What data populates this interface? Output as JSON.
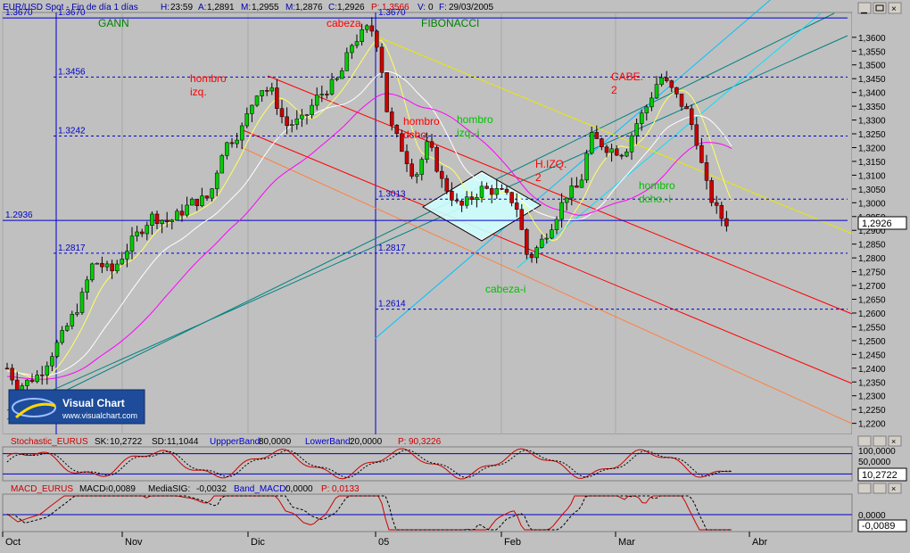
{
  "header": {
    "symbol": "EUR/USD Spot - Fin de día 1 días",
    "h_label": "H:",
    "h_val": "23:59",
    "a_label": "A:",
    "a_val": "1,2891",
    "m_label": "M:",
    "m_val": "1,2955",
    "m2_label": "M:",
    "m2_val": "1,2876",
    "c_label": "C:",
    "c_val": "1,2926",
    "p_label": "P:",
    "p_val": "1,3566",
    "v_label": "V:",
    "v_val": "0",
    "f_label": "F:",
    "f_val": "29/03/2005"
  },
  "stoch_header": {
    "name": "Stochastic_EURUS",
    "sk_label": "SK:",
    "sk_val": "10,2722",
    "sd_label": "SD:",
    "sd_val": "11,1044",
    "up_label": "UppperBand:",
    "up_val": "80,0000",
    "low_label": "LowerBand:",
    "low_val": "20,0000",
    "p_label": "P:",
    "p_val": "90,3226"
  },
  "macd_header": {
    "name": "MACD_EURUS",
    "macd_label": "MACD:",
    "macd_val": "-0,0089",
    "sig_label": "MediaSIG:",
    "sig_val": "-0,0032",
    "band_label": "Band_MACD:",
    "band_val": "0,0000",
    "p_label": "P:",
    "p_val": "0,0133"
  },
  "logo": {
    "title": "Visual Chart",
    "url": "www.visualchart.com"
  },
  "colors": {
    "bg": "#c0c0c0",
    "plot": "#c0c0c0",
    "up": "#00cc00",
    "down": "#cc0000",
    "hline": "#0000cc"
  },
  "chart_data": {
    "type": "candlestick",
    "y_ticks": [
      "1,3600",
      "1,3550",
      "1,3500",
      "1,3450",
      "1,3400",
      "1,3350",
      "1,3300",
      "1,3250",
      "1,3200",
      "1,3150",
      "1,3100",
      "1,3050",
      "1,3000",
      "1,2950",
      "1,2900",
      "1,2850",
      "1,2800",
      "1,2750",
      "1,2700",
      "1,2650",
      "1,2600",
      "1,2550",
      "1,2500",
      "1,2450",
      "1,2400",
      "1,2350",
      "1,2300",
      "1,2250",
      "1,2200"
    ],
    "ylim": [
      1.216,
      1.369
    ],
    "x_labels": [
      "Oct",
      "Nov",
      "Dic",
      "05",
      "Feb",
      "Mar",
      "Abr"
    ],
    "current_price": "1,2926",
    "levels": [
      {
        "label": "1.3670",
        "value": 1.367
      },
      {
        "label": "1.3456",
        "value": 1.3456
      },
      {
        "label": "1.3242",
        "value": 1.3242
      },
      {
        "label": "1.3013",
        "value": 1.3013
      },
      {
        "label": "1.2936",
        "value": 1.2936
      },
      {
        "label": "1.2817",
        "value": 1.2817
      },
      {
        "label": "1.2614",
        "value": 1.2614
      }
    ],
    "annotations": [
      {
        "text": "GANN"
      },
      {
        "text": "FIBONACCI"
      },
      {
        "text": "cabeza"
      },
      {
        "text": "hombro izq."
      },
      {
        "text": "hombro dcho."
      },
      {
        "text": "hombro izq.-i"
      },
      {
        "text": "H.IZQ. 2"
      },
      {
        "text": "CABE. 2"
      },
      {
        "text": "hombro dcho.-i"
      },
      {
        "text": "cabeza-i"
      }
    ],
    "stochastic": {
      "y_ticks": [
        "100,0000",
        "50,0000"
      ],
      "current": "10,2722"
    },
    "macd": {
      "y_ticks": [
        "0,0000"
      ],
      "current": "-0,0089"
    }
  }
}
